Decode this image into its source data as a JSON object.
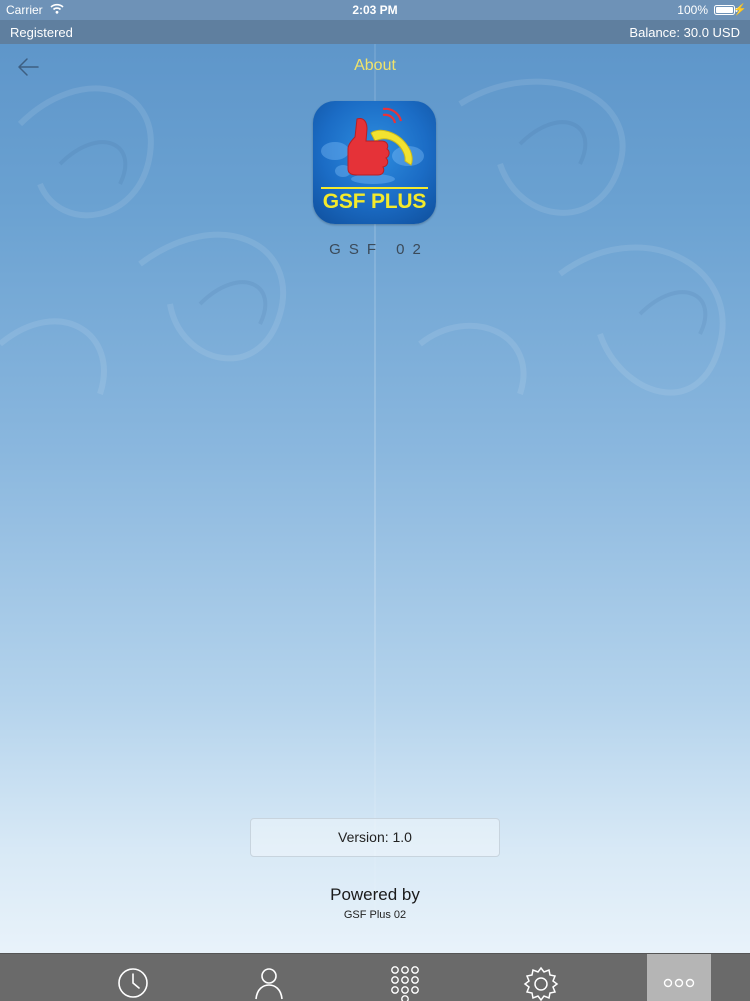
{
  "status_bar": {
    "carrier": "Carrier",
    "time": "2:03 PM",
    "battery_percent": "100%",
    "wifi_icon": "wifi-icon",
    "battery_icon": "battery-icon",
    "charging_icon": "charging-bolt-icon"
  },
  "account_bar": {
    "registration_status": "Registered",
    "balance": "Balance: 30.0 USD"
  },
  "nav": {
    "title": "About",
    "back_icon": "arrow-left-icon",
    "title_color": "#f0e36a"
  },
  "app": {
    "logo_text": "GSF PLUS",
    "name": "GSF 02",
    "logo_icon": "thumbs-up-phone-icon"
  },
  "version": {
    "label": "Version: 1.0"
  },
  "footer": {
    "powered_by": "Powered by",
    "company": "GSF Plus 02"
  },
  "tab_bar": {
    "tabs": [
      {
        "icon": "clock-icon",
        "active": false
      },
      {
        "icon": "person-icon",
        "active": false
      },
      {
        "icon": "dialpad-icon",
        "active": false
      },
      {
        "icon": "gear-icon",
        "active": false
      },
      {
        "icon": "more-icon",
        "active": true
      }
    ]
  },
  "colors": {
    "accent_yellow": "#f4ea2c",
    "tab_bar_bg": "#6a6a6a",
    "active_tab_bg": "#b5b5b5"
  }
}
